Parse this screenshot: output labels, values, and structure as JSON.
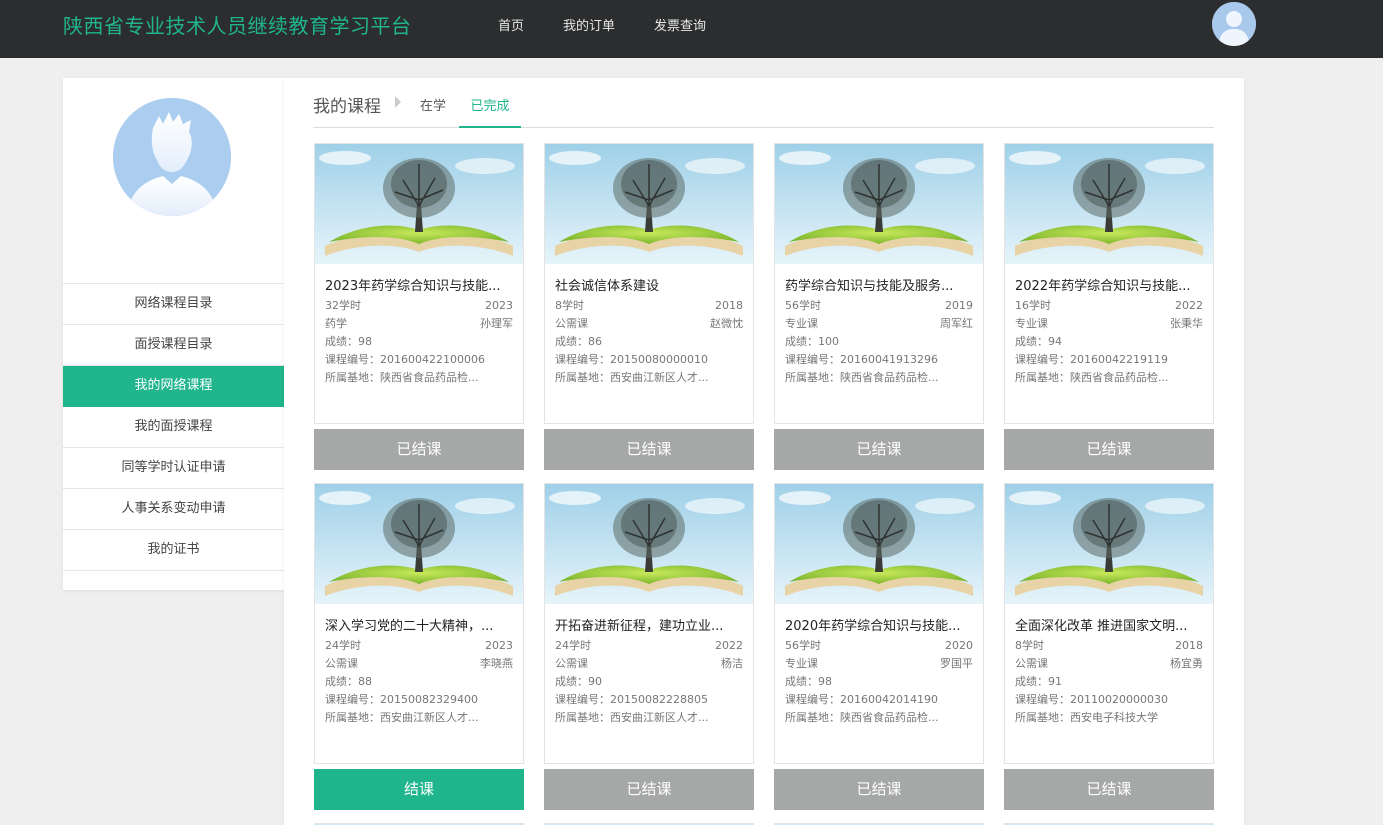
{
  "header": {
    "site_title": "陕西省专业技术人员继续教育学习平台",
    "nav": [
      "首页",
      "我的订单",
      "发票查询"
    ]
  },
  "sidebar": {
    "menu": [
      "网络课程目录",
      "面授课程目录",
      "我的网络课程",
      "我的面授课程",
      "同等学时认证申请",
      "人事关系变动申请",
      "我的证书"
    ],
    "active_index": 2
  },
  "main": {
    "crumb": "我的课程",
    "tabs": [
      "在学",
      "已完成"
    ],
    "active_tab": "已完成"
  },
  "labels": {
    "score": "成绩：",
    "code": "课程编号：",
    "base": "所属基地："
  },
  "colors": {
    "accent": "#20b58c",
    "ended_button": "#a5a8a7",
    "topbar": "#2b2d2f"
  },
  "courses": [
    {
      "title": "2023年药学综合知识与技能...",
      "hours": "32学时",
      "year": "2023",
      "type": "药学",
      "teacher": "孙理军",
      "score": "98",
      "code": "201600422100006",
      "base": "陕西省食品药品检...",
      "button": "已结课"
    },
    {
      "title": "社会诚信体系建设",
      "hours": "8学时",
      "year": "2018",
      "type": "公需课",
      "teacher": "赵微忱",
      "score": "86",
      "code": "20150080000010",
      "base": "西安曲江新区人才...",
      "button": "已结课"
    },
    {
      "title": "药学综合知识与技能及服务...",
      "hours": "56学时",
      "year": "2019",
      "type": "专业课",
      "teacher": "周军红",
      "score": "100",
      "code": "20160041913296",
      "base": "陕西省食品药品检...",
      "button": "已结课"
    },
    {
      "title": "2022年药学综合知识与技能...",
      "hours": "16学时",
      "year": "2022",
      "type": "专业课",
      "teacher": "张秉华",
      "score": "94",
      "code": "20160042219119",
      "base": "陕西省食品药品检...",
      "button": "已结课"
    },
    {
      "title": "深入学习党的二十大精神，...",
      "hours": "24学时",
      "year": "2023",
      "type": "公需课",
      "teacher": "李晓燕",
      "score": "88",
      "code": "20150082329400",
      "base": "西安曲江新区人才...",
      "button": "结课"
    },
    {
      "title": "开拓奋进新征程，建功立业...",
      "hours": "24学时",
      "year": "2022",
      "type": "公需课",
      "teacher": "杨洁",
      "score": "90",
      "code": "20150082228805",
      "base": "西安曲江新区人才...",
      "button": "已结课"
    },
    {
      "title": "2020年药学综合知识与技能...",
      "hours": "56学时",
      "year": "2020",
      "type": "专业课",
      "teacher": "罗国平",
      "score": "98",
      "code": "20160042014190",
      "base": "陕西省食品药品检...",
      "button": "已结课"
    },
    {
      "title": "全面深化改革 推进国家文明...",
      "hours": "8学时",
      "year": "2018",
      "type": "公需课",
      "teacher": "杨宜勇",
      "score": "91",
      "code": "20110020000030",
      "base": "西安电子科技大学",
      "button": "已结课"
    }
  ]
}
